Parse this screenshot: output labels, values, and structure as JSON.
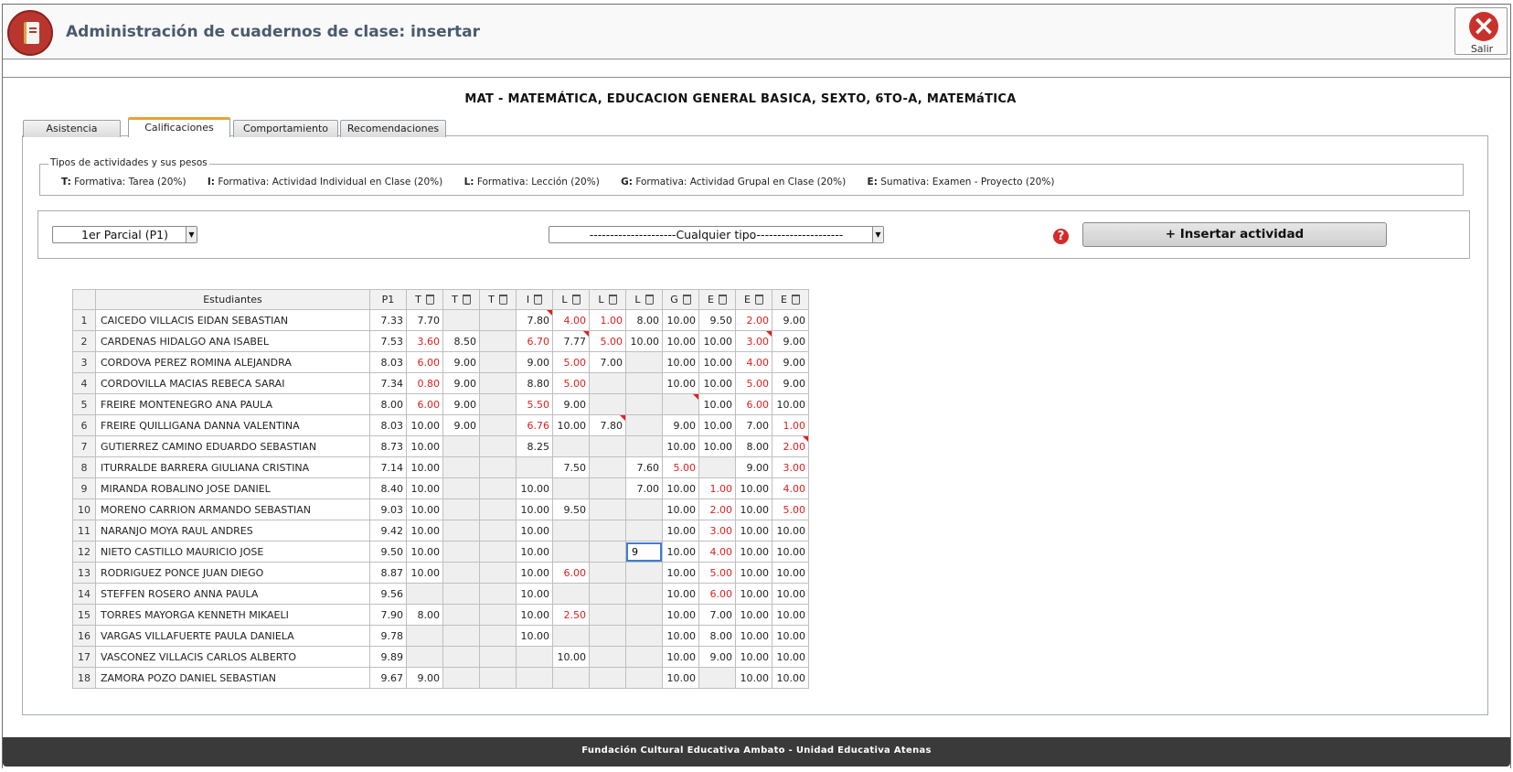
{
  "app": {
    "title": "Administración de cuadernos de clase: insertar",
    "exit_label": "Salir"
  },
  "course_title": "MAT - MATEMÁTICA, EDUCACION GENERAL BASICA, SEXTO, 6TO-A, MATEMáTICA",
  "tabs": [
    {
      "label": "Asistencia",
      "active": false
    },
    {
      "label": "Calificaciones",
      "active": true
    },
    {
      "label": "Comportamiento",
      "active": false
    },
    {
      "label": "Recomendaciones",
      "active": false
    }
  ],
  "activity_types": {
    "legend": "Tipos de actividades y sus pesos",
    "items": [
      {
        "code": "T:",
        "desc": "Formativa: Tarea (20%)"
      },
      {
        "code": "I:",
        "desc": "Formativa: Actividad Individual en Clase (20%)"
      },
      {
        "code": "L:",
        "desc": "Formativa: Lección (20%)"
      },
      {
        "code": "G:",
        "desc": "Formativa: Actividad Grupal en Clase (20%)"
      },
      {
        "code": "E:",
        "desc": "Sumativa: Examen - Proyecto (20%)"
      }
    ]
  },
  "toolbar": {
    "partial_select": "1er Parcial (P1)",
    "type_select": "---------------------Cualquier tipo---------------------",
    "insert_button": "+ Insertar actividad",
    "help_icon": "question-icon"
  },
  "grades_table": {
    "headers": {
      "students": "Estudiantes",
      "p1": "P1"
    },
    "activity_columns": [
      "T",
      "T",
      "T",
      "I",
      "L",
      "L",
      "L",
      "G",
      "E",
      "E",
      "E"
    ],
    "rows": [
      {
        "n": "1",
        "name": "CAICEDO VILLACIS EIDAN SEBASTIAN",
        "p1": "7.33",
        "grades": [
          "7.70",
          "",
          "",
          "7.80",
          "4.00",
          "1.00",
          "8.00",
          "10.00",
          "9.50",
          "2.00",
          "9.00"
        ]
      },
      {
        "n": "2",
        "name": "CARDENAS HIDALGO ANA ISABEL",
        "p1": "7.53",
        "grades": [
          "3.60",
          "8.50",
          "",
          "6.70",
          "7.77",
          "5.00",
          "10.00",
          "10.00",
          "10.00",
          "3.00",
          "9.00"
        ]
      },
      {
        "n": "3",
        "name": "CORDOVA PEREZ ROMINA ALEJANDRA",
        "p1": "8.03",
        "grades": [
          "6.00",
          "9.00",
          "",
          "9.00",
          "5.00",
          "7.00",
          "",
          "10.00",
          "10.00",
          "4.00",
          "9.00"
        ]
      },
      {
        "n": "4",
        "name": "CORDOVILLA MACIAS REBECA SARAI",
        "p1": "7.34",
        "grades": [
          "0.80",
          "9.00",
          "",
          "8.80",
          "5.00",
          "",
          "",
          "10.00",
          "10.00",
          "5.00",
          "9.00"
        ]
      },
      {
        "n": "5",
        "name": "FREIRE MONTENEGRO ANA PAULA",
        "p1": "8.00",
        "grades": [
          "6.00",
          "9.00",
          "",
          "5.50",
          "9.00",
          "",
          "",
          "",
          "10.00",
          "6.00",
          "10.00"
        ]
      },
      {
        "n": "6",
        "name": "FREIRE QUILLIGANA DANNA VALENTINA",
        "p1": "8.03",
        "grades": [
          "10.00",
          "9.00",
          "",
          "6.76",
          "10.00",
          "7.80",
          "",
          "9.00",
          "10.00",
          "7.00",
          "1.00"
        ]
      },
      {
        "n": "7",
        "name": "GUTIERREZ CAMINO EDUARDO SEBASTIAN",
        "p1": "8.73",
        "grades": [
          "10.00",
          "",
          "",
          "8.25",
          "",
          "",
          "",
          "10.00",
          "10.00",
          "8.00",
          "2.00"
        ]
      },
      {
        "n": "8",
        "name": "ITURRALDE BARRERA GIULIANA CRISTINA",
        "p1": "7.14",
        "grades": [
          "10.00",
          "",
          "",
          "",
          "7.50",
          "",
          "7.60",
          "5.00",
          "",
          "9.00",
          "3.00"
        ]
      },
      {
        "n": "9",
        "name": "MIRANDA ROBALINO JOSE DANIEL",
        "p1": "8.40",
        "grades": [
          "10.00",
          "",
          "",
          "10.00",
          "",
          "",
          "7.00",
          "10.00",
          "1.00",
          "10.00",
          "4.00"
        ]
      },
      {
        "n": "10",
        "name": "MORENO CARRION ARMANDO SEBASTIAN",
        "p1": "9.03",
        "grades": [
          "10.00",
          "",
          "",
          "10.00",
          "9.50",
          "",
          "",
          "10.00",
          "2.00",
          "10.00",
          "5.00"
        ]
      },
      {
        "n": "11",
        "name": "NARANJO MOYA RAUL ANDRES",
        "p1": "9.42",
        "grades": [
          "10.00",
          "",
          "",
          "10.00",
          "",
          "",
          "",
          "10.00",
          "3.00",
          "10.00",
          "10.00"
        ]
      },
      {
        "n": "12",
        "name": "NIETO CASTILLO MAURICIO JOSE",
        "p1": "9.50",
        "grades": [
          "10.00",
          "",
          "",
          "10.00",
          "",
          "",
          "9",
          "10.00",
          "4.00",
          "10.00",
          "10.00"
        ]
      },
      {
        "n": "13",
        "name": "RODRIGUEZ PONCE JUAN DIEGO",
        "p1": "8.87",
        "grades": [
          "10.00",
          "",
          "",
          "10.00",
          "6.00",
          "",
          "",
          "10.00",
          "5.00",
          "10.00",
          "10.00"
        ]
      },
      {
        "n": "14",
        "name": "STEFFEN ROSERO ANNA PAULA",
        "p1": "9.56",
        "grades": [
          "",
          "",
          "",
          "10.00",
          "",
          "",
          "",
          "10.00",
          "6.00",
          "10.00",
          "10.00"
        ]
      },
      {
        "n": "15",
        "name": "TORRES MAYORGA KENNETH MIKAELI",
        "p1": "7.90",
        "grades": [
          "8.00",
          "",
          "",
          "10.00",
          "2.50",
          "",
          "",
          "10.00",
          "7.00",
          "10.00",
          "10.00"
        ]
      },
      {
        "n": "16",
        "name": "VARGAS VILLAFUERTE PAULA DANIELA",
        "p1": "9.78",
        "grades": [
          "",
          "",
          "",
          "10.00",
          "",
          "",
          "",
          "10.00",
          "8.00",
          "10.00",
          "10.00"
        ]
      },
      {
        "n": "17",
        "name": "VASCONEZ VILLACIS CARLOS ALBERTO",
        "p1": "9.89",
        "grades": [
          "",
          "",
          "",
          "",
          "10.00",
          "",
          "",
          "10.00",
          "9.00",
          "10.00",
          "10.00"
        ]
      },
      {
        "n": "18",
        "name": "ZAMORA POZO DANIEL SEBASTIAN",
        "p1": "9.67",
        "grades": [
          "9.00",
          "",
          "",
          "",
          "",
          "",
          "",
          "10.00",
          "",
          "10.00",
          "10.00"
        ]
      }
    ],
    "flagged_cells": [
      [
        0,
        3
      ],
      [
        1,
        4
      ],
      [
        1,
        9
      ],
      [
        4,
        7
      ],
      [
        5,
        5
      ],
      [
        6,
        10
      ]
    ],
    "editing_cell": [
      11,
      6
    ],
    "low_grade_color": "#e02020"
  },
  "footer": "Fundación Cultural Educativa Ambato - Unidad Educativa Atenas"
}
